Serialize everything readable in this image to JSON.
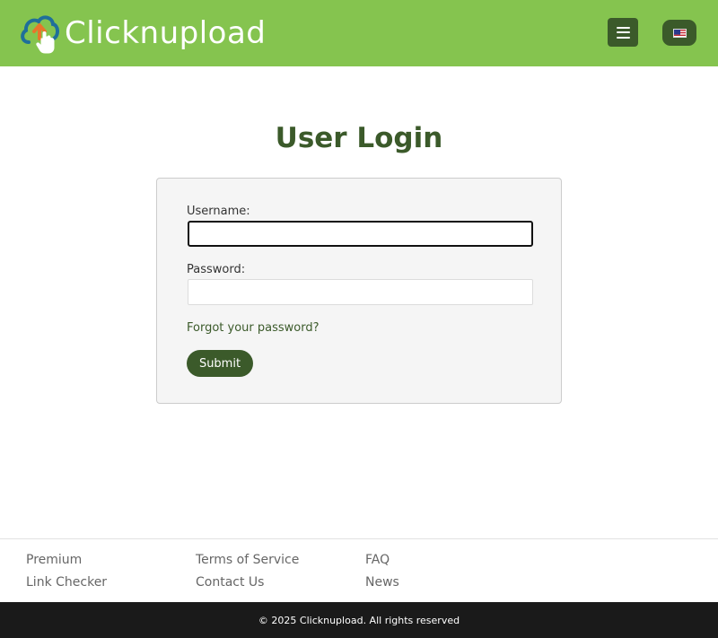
{
  "header": {
    "brand": "Clicknupload",
    "menu_icon": "hamburger-menu-icon",
    "language_icon": "us-flag-icon",
    "colors": {
      "header_bg": "#85c44f",
      "accent": "#3b5a2a"
    }
  },
  "login": {
    "title": "User Login",
    "username_label": "Username:",
    "username_value": "",
    "password_label": "Password:",
    "password_value": "",
    "forgot_link": "Forgot your password?",
    "submit_label": "Submit"
  },
  "footer": {
    "col1": [
      "Premium",
      "Link Checker"
    ],
    "col2": [
      "Terms of Service",
      "Contact Us"
    ],
    "col3": [
      "FAQ",
      "News"
    ],
    "copyright_prefix": "© 2025 ",
    "copyright_brand": "Clicknupload",
    "copyright_suffix": ". All rights reserved"
  }
}
